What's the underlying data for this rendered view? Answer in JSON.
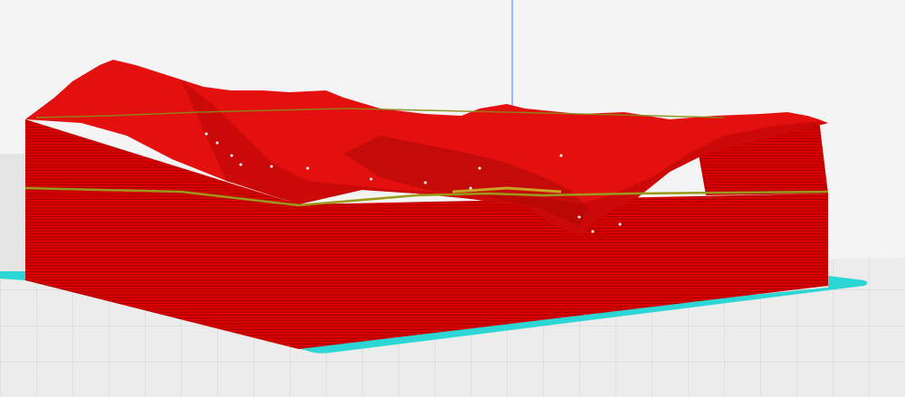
{
  "viewer": {
    "mode": "layer-preview",
    "colors": {
      "background": "#f4f4f4",
      "grid_line": "#d0d0d0",
      "bed_plate": "#e8e8e8",
      "brim": "#2bd6d4",
      "model_wall": "#d80000",
      "model_top": "#ea1414",
      "layer_line": "#5a0000",
      "seam_highlight": "#9a9a1a",
      "axis_line": "#7aa7ff"
    },
    "model": {
      "name": "terrain-relief",
      "shown_layer_fraction": 0.72
    }
  }
}
